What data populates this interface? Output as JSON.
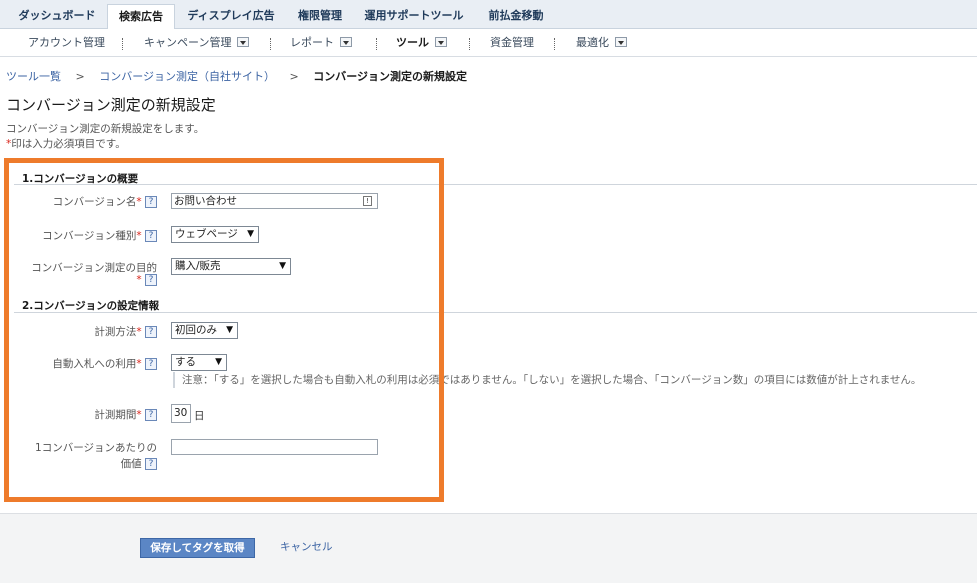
{
  "topnav": {
    "tabs": [
      {
        "label": "ダッシュボード"
      },
      {
        "label": "検索広告"
      },
      {
        "label": "ディスプレイ広告"
      },
      {
        "label": "権限管理"
      },
      {
        "label": "運用サポートツール"
      },
      {
        "label": "前払金移動"
      }
    ],
    "active": "検索広告"
  },
  "subnav": {
    "items": [
      {
        "label": "アカウント管理"
      },
      {
        "label": "キャンペーン管理"
      },
      {
        "label": "レポート"
      },
      {
        "label": "ツール"
      },
      {
        "label": "資金管理"
      },
      {
        "label": "最適化"
      }
    ]
  },
  "breadcrumb": {
    "link1": "ツール一覧",
    "arrow1": ">",
    "link2": "コンバージョン測定（自社サイト）",
    "arrow2": ">",
    "current": "コンバージョン測定の新規設定"
  },
  "page": {
    "title": "コンバージョン測定の新規設定",
    "description": "コンバージョン測定の新規設定をします。",
    "required_star": "*",
    "required_note": "印は入力必須項目です。"
  },
  "section1": {
    "title": "1.コンバージョンの概要",
    "fields": {
      "name_label": "コンバージョン名",
      "name_value": "お問い合わせ",
      "type_label": "コンバージョン種別",
      "type_value": "ウェブページ",
      "purpose_label": "コンバージョン測定の目的",
      "purpose_value": "購入/販売"
    }
  },
  "section2": {
    "title": "2.コンバージョンの設定情報",
    "fields": {
      "method_label": "計測方法",
      "method_value": "初回のみ",
      "autobid_label": "自動入札への利用",
      "autobid_value": "する",
      "autobid_note": "注意：「する」を選択した場合も自動入札の利用は必須ではありません。「しない」を選択した場合、「コンバージョン数」の項目には数値が計上されません。",
      "period_label": "計測期間",
      "period_value": "30",
      "period_unit": "日",
      "value_label_1": "1コンバージョンあたりの",
      "value_label_2": "価値",
      "value_value": ""
    }
  },
  "common": {
    "star": "*",
    "help": "?",
    "arrow": "▼"
  },
  "footer": {
    "save_label": "保存してタグを取得",
    "cancel_label": "キャンセル"
  },
  "colors": {
    "frame": "#ee7b2b",
    "save_button": "#5b86c5",
    "link": "#3b63a3",
    "required": "#d9261c"
  }
}
